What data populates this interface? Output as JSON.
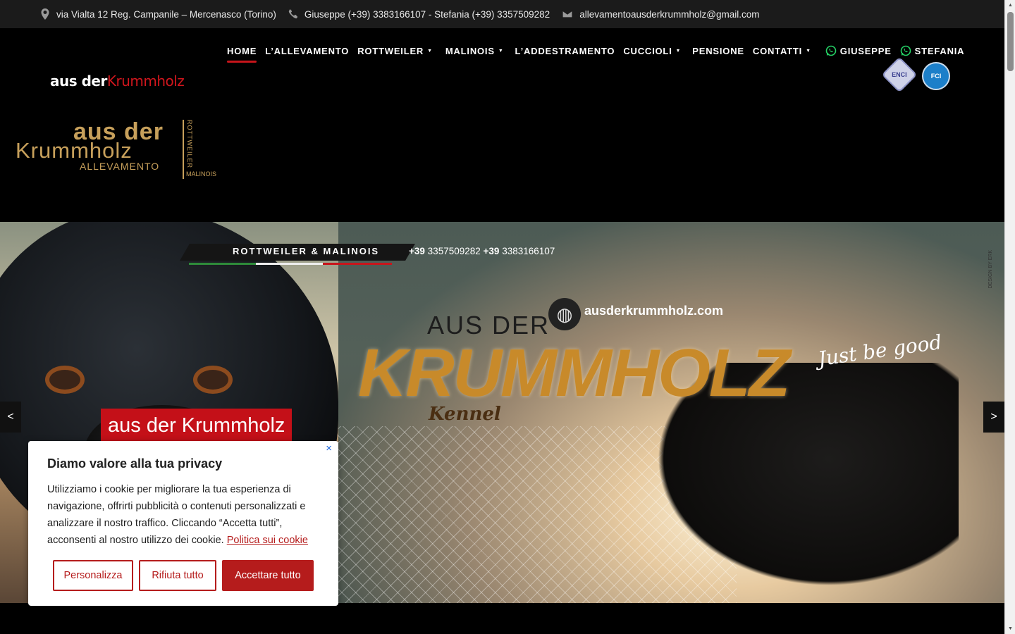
{
  "topbar": {
    "address": "via Vialta 12 Reg. Campanile – Mercenasco (Torino)",
    "phones": "Giuseppe (+39) 3383166107 - Stefania (+39) 3357509282",
    "email": "allevamentoausderkrummholz@gmail.com",
    "icons": [
      "map-pin-icon",
      "phone-icon",
      "envelope-icon"
    ]
  },
  "nav": {
    "brand_white": "aus der",
    "brand_red": "Krummholz",
    "items": [
      {
        "label": "HOME",
        "active": true,
        "dropdown": false
      },
      {
        "label": "L’ALLEVAMENTO",
        "active": false,
        "dropdown": false
      },
      {
        "label": "ROTTWEILER",
        "active": false,
        "dropdown": true
      },
      {
        "label": "MALINOIS",
        "active": false,
        "dropdown": true
      },
      {
        "label": "L’ADDESTRAMENTO",
        "active": false,
        "dropdown": false
      },
      {
        "label": "CUCCIOLI",
        "active": false,
        "dropdown": true
      },
      {
        "label": "PENSIONE",
        "active": false,
        "dropdown": false
      },
      {
        "label": "CONTATTI",
        "active": false,
        "dropdown": true
      }
    ],
    "whatsapp": [
      {
        "label": "GIUSEPPE"
      },
      {
        "label": "STEFANIA"
      }
    ],
    "badges": [
      "ENCI",
      "FCI"
    ]
  },
  "logo": {
    "line1": "aus der",
    "line2": "Krummholz",
    "line3": "ALLEVAMENTO",
    "side1": "ROTTWEILER",
    "side2": "MALINOIS"
  },
  "slider": {
    "strip": "ROTTWEILER & MALINOIS",
    "phone1_prefix": "+39",
    "phone1": "3357509282",
    "phone2_prefix": "+39",
    "phone2": "3383166107",
    "aus_der": "AUS DER",
    "krummholz": "KRUMMHOLZ",
    "kennel": "Kennel",
    "site": "ausderkrummholz.com",
    "tagline": "Just be good",
    "design_by": "DESIGN BY ERK",
    "caption": "aus der Krummholz",
    "prev": "<",
    "next": ">"
  },
  "cookie": {
    "title": "Diamo valore alla tua privacy",
    "body": "Utilizziamo i cookie per migliorare la tua esperienza di navigazione, offrirti pubblicità o contenuti personalizzati e analizzare il nostro traffico. Cliccando “Accetta tutti”, acconsenti al nostro utilizzo dei cookie.",
    "policy_link": "Politica sui cookie",
    "btn_customize": "Personalizza",
    "btn_reject": "Rifiuta tutto",
    "btn_accept": "Accettare tutto",
    "close": "×"
  },
  "colors": {
    "accent_red": "#c8151b",
    "whatsapp_green": "#25d366",
    "gold": "#c7a05b"
  }
}
